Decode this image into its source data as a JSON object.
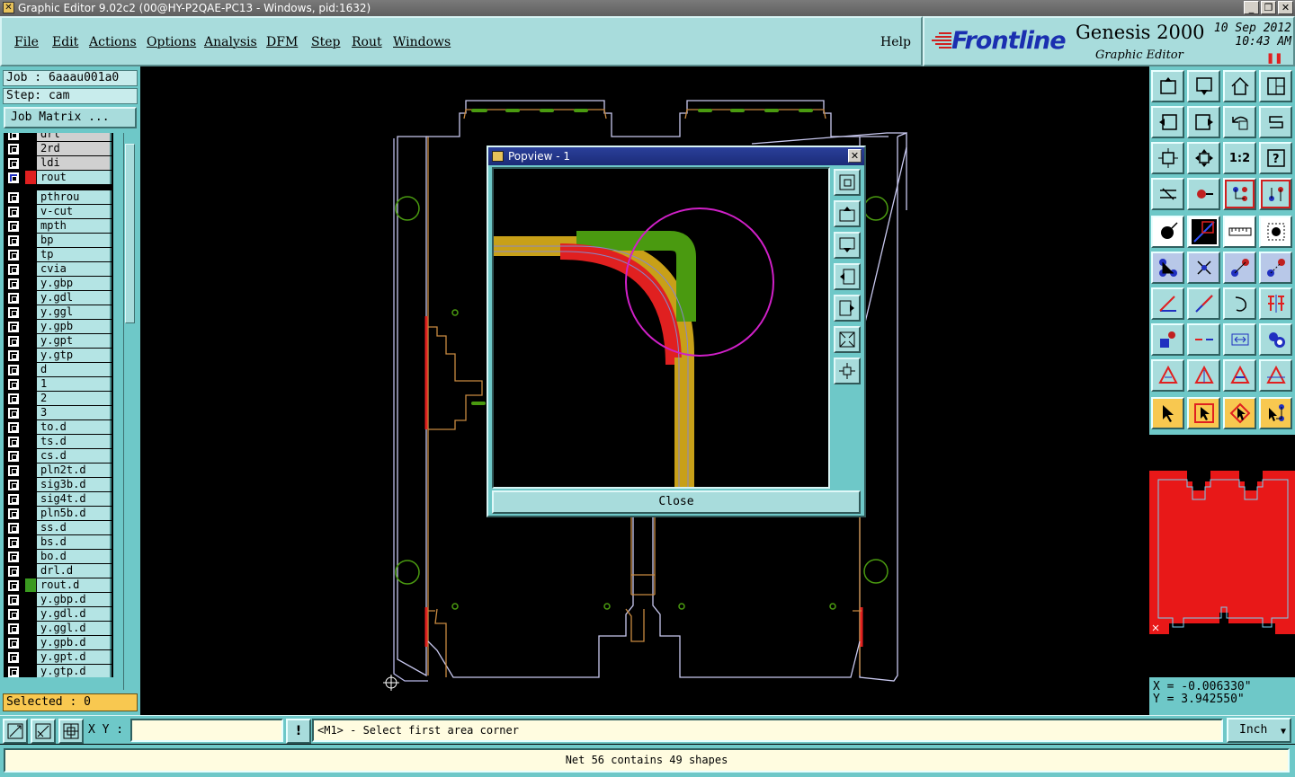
{
  "window": {
    "title": "Graphic Editor 9.02c2 (00@HY-P2QAE-PC13 - Windows, pid:1632)",
    "buttons": [
      "_",
      "❐",
      "✕"
    ]
  },
  "menu": {
    "items": [
      "File",
      "Edit",
      "Actions",
      "Options",
      "Analysis",
      "DFM",
      "Step",
      "Rout",
      "Windows"
    ],
    "help": "Help"
  },
  "brand": {
    "logo": "Frontline",
    "product": "Genesis 2000",
    "subtitle": "Graphic Editor",
    "date": "10 Sep 2012",
    "time": "10:43 AM",
    "pause_icon": "pause-icon"
  },
  "job": {
    "job_label": "Job : 6aaau001a0",
    "step_label": "Step: cam",
    "matrix_button": "Job Matrix ..."
  },
  "layers_top": [
    {
      "name": "drl",
      "color": "#000000",
      "gray": true
    },
    {
      "name": "2rd",
      "color": "#000000",
      "gray": true
    },
    {
      "name": "ldi",
      "color": "#000000",
      "gray": true
    },
    {
      "name": "rout",
      "color": "#e02020",
      "gray": false,
      "active": true
    }
  ],
  "layers": [
    {
      "name": "pthrou",
      "color": "#000000"
    },
    {
      "name": "v-cut",
      "color": "#000000"
    },
    {
      "name": "mpth",
      "color": "#000000"
    },
    {
      "name": "bp",
      "color": "#000000"
    },
    {
      "name": "tp",
      "color": "#000000"
    },
    {
      "name": "cvia",
      "color": "#000000"
    },
    {
      "name": "y.gbp",
      "color": "#000000"
    },
    {
      "name": "y.gdl",
      "color": "#000000"
    },
    {
      "name": "y.ggl",
      "color": "#000000"
    },
    {
      "name": "y.gpb",
      "color": "#000000"
    },
    {
      "name": "y.gpt",
      "color": "#000000"
    },
    {
      "name": "y.gtp",
      "color": "#000000"
    },
    {
      "name": "d",
      "color": "#000000"
    },
    {
      "name": "1",
      "color": "#000000"
    },
    {
      "name": "2",
      "color": "#000000"
    },
    {
      "name": "3",
      "color": "#000000"
    },
    {
      "name": "to.d",
      "color": "#000000"
    },
    {
      "name": "ts.d",
      "color": "#000000"
    },
    {
      "name": "cs.d",
      "color": "#000000"
    },
    {
      "name": "pln2t.d",
      "color": "#000000"
    },
    {
      "name": "sig3b.d",
      "color": "#000000"
    },
    {
      "name": "sig4t.d",
      "color": "#000000"
    },
    {
      "name": "pln5b.d",
      "color": "#000000"
    },
    {
      "name": "ss.d",
      "color": "#000000"
    },
    {
      "name": "bs.d",
      "color": "#000000"
    },
    {
      "name": "bo.d",
      "color": "#000000"
    },
    {
      "name": "drl.d",
      "color": "#000000"
    },
    {
      "name": "rout.d",
      "color": "#3a9a20"
    },
    {
      "name": "y.gbp.d",
      "color": "#000000"
    },
    {
      "name": "y.gdl.d",
      "color": "#000000"
    },
    {
      "name": "y.ggl.d",
      "color": "#000000"
    },
    {
      "name": "y.gpb.d",
      "color": "#000000"
    },
    {
      "name": "y.gpt.d",
      "color": "#000000"
    },
    {
      "name": "y.gtp.d",
      "color": "#000000"
    }
  ],
  "selected": "Selected : 0",
  "popview": {
    "title": "Popview - 1",
    "close_x": "✕",
    "close_button": "Close"
  },
  "coords": {
    "x": "X = -0.006330\"",
    "y": "Y = 3.942550\""
  },
  "command": {
    "xy_label": "X Y :",
    "xy_value": "",
    "warn_icon": "!",
    "prompt": "<M1> - Select first area corner",
    "units": "Inch",
    "units_arrow": "▼"
  },
  "status": "Net 56 contains 49 shapes",
  "colors": {
    "panel": "#6ec8c8",
    "button": "#a8dcdc",
    "selected_bg": "#f8c850",
    "rout_red": "#e02020",
    "trace_yellow": "#c8a018",
    "trace_green": "#4a9a10",
    "magenta": "#d020c8"
  }
}
